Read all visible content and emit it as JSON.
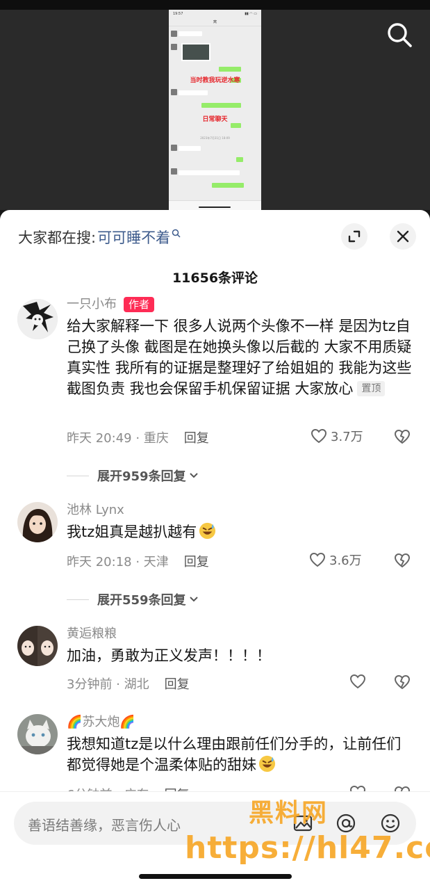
{
  "video": {
    "status_time": "19:57",
    "chat_title": "窝",
    "overlay_text_1": "当时教我玩逆水寒",
    "overlay_text_2": "日常聊天",
    "chat_date": "2023年7月31日 18:09"
  },
  "search_icon": "search-icon",
  "sheet": {
    "hot_search_prefix": "大家都在搜:",
    "hot_search_term": "可可睡不着",
    "count_title": "11656条评论"
  },
  "comments": [
    {
      "name": "一只小布",
      "author_tag": "作者",
      "text": "给大家解释一下 很多人说两个头像不一样 是因为tz自己换了头像 截图是在她换头像以后截的 大家不用质疑真实性 我所有的证据是整理好了给姐姐的 我能为这些截图负责 我也会保留手机保留证据 大家放心",
      "pin_tag": "置顶",
      "time_loc": "昨天 20:49 · 重庆",
      "reply": "回复",
      "likes": "3.7万",
      "expand": "展开959条回复"
    },
    {
      "name": "池林 Lynx",
      "text": "我tz姐真是越扒越有",
      "time_loc": "昨天 20:18 · 天津",
      "reply": "回复",
      "likes": "3.6万",
      "expand": "展开559条回复"
    },
    {
      "name": "黄逅粮粮",
      "text": "加油，勇敢为正义发声！！！！",
      "time_loc": "3分钟前 · 湖北",
      "reply": "回复",
      "likes": ""
    },
    {
      "name": "🌈苏大炮🌈",
      "text": "我想知道tz是以什么理由跟前任们分手的，让前任们都觉得她是个温柔体贴的甜妹",
      "time_loc": "6分钟前 · 广东",
      "reply": "回复",
      "likes": ""
    }
  ],
  "input": {
    "placeholder": "善语结善缘，恶言伤人心"
  },
  "watermark": {
    "line1": "黑料网",
    "line2": "https://hl47.co"
  }
}
